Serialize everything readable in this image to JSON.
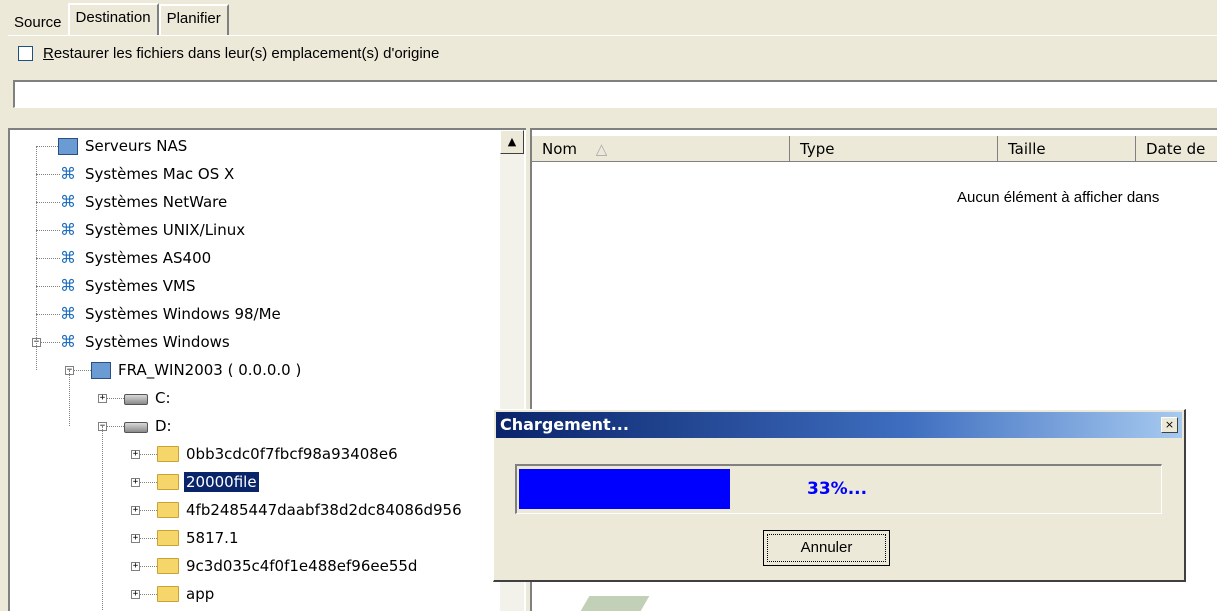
{
  "tabs": [
    "Source",
    "Destination",
    "Planifier"
  ],
  "restore_checkbox": {
    "label_first_letter": "R",
    "label_rest": "estaurer les fichiers dans leur(s) emplacement(s) d'origine",
    "checked": false
  },
  "path_field": {
    "value": ""
  },
  "tree": {
    "items": [
      {
        "label": "Serveurs NAS",
        "icon": "nas-server-icon"
      },
      {
        "label": "Systèmes Mac OS X",
        "icon": "network-icon"
      },
      {
        "label": "Systèmes NetWare",
        "icon": "network-icon"
      },
      {
        "label": "Systèmes UNIX/Linux",
        "icon": "network-icon"
      },
      {
        "label": "Systèmes AS400",
        "icon": "network-icon"
      },
      {
        "label": "Systèmes VMS",
        "icon": "network-icon"
      },
      {
        "label": "Systèmes Windows 98/Me",
        "icon": "network-icon"
      },
      {
        "label": "Systèmes Windows",
        "icon": "network-icon"
      },
      {
        "label": "FRA_WIN2003 ( 0.0.0.0 )",
        "icon": "server-icon"
      },
      {
        "label": "C:",
        "icon": "drive-icon"
      },
      {
        "label": "D:",
        "icon": "drive-icon"
      },
      {
        "label": "0bb3cdc0f7fbcf98a93408e6",
        "icon": "folder-icon"
      },
      {
        "label": "20000file",
        "icon": "folder-icon",
        "selected": true
      },
      {
        "label": "4fb2485447daabf38d2dc84086d956",
        "icon": "folder-icon"
      },
      {
        "label": "5817.1",
        "icon": "folder-icon"
      },
      {
        "label": "9c3d035c4f0f1e488ef96ee55d",
        "icon": "folder-icon"
      },
      {
        "label": "app",
        "icon": "folder-icon"
      }
    ]
  },
  "list": {
    "columns": [
      "Nom",
      "Type",
      "Taille",
      "Date de"
    ],
    "empty_message": "Aucun élément à afficher dans"
  },
  "loading_dialog": {
    "title": "Chargement...",
    "close_symbol": "×",
    "progress_fraction": 0.33,
    "progress_text": "33%...",
    "cancel_label": "Annuler"
  },
  "colors": {
    "progress_fill": "#0000ff",
    "titlebar_start": "#0a246a",
    "titlebar_end": "#a6caf0",
    "selection": "#0a246a"
  }
}
